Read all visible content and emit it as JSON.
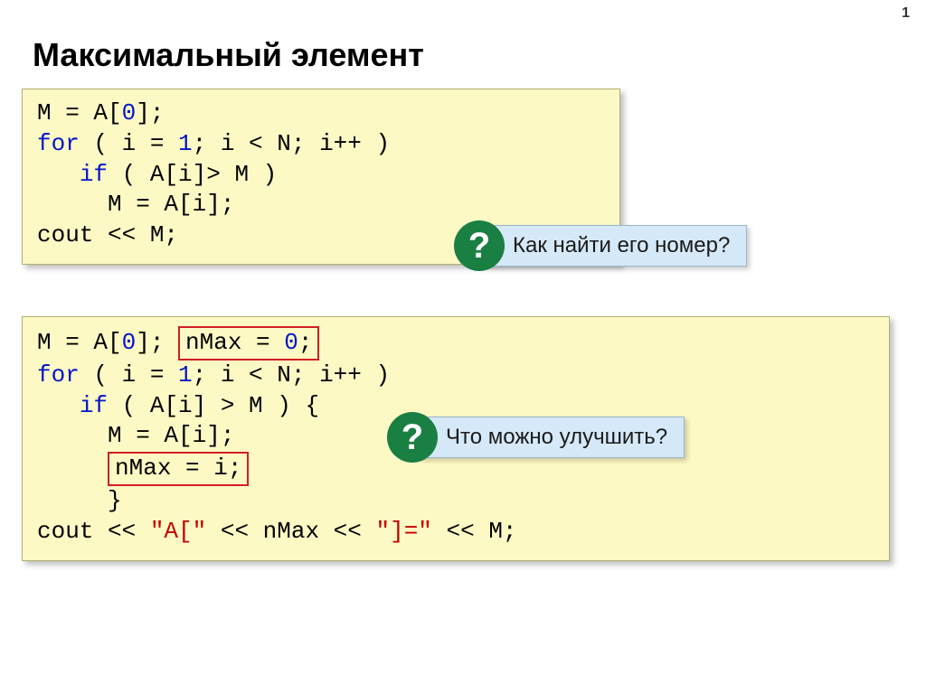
{
  "page_number": "1",
  "title": "Максимальный элемент",
  "code1": {
    "line1_a": "M = A[",
    "line1_zero": "0",
    "line1_b": "];",
    "line2_for": "for",
    "line2_a": " ( i = ",
    "line2_one": "1",
    "line2_b": "; i < N; i++ )",
    "line3_if": "if",
    "line3_body": " ( A[i]> M )",
    "line4": "     M = A[i];",
    "line5": "cout << M;"
  },
  "question1": {
    "mark": "?",
    "text": "Как найти его номер?"
  },
  "code2": {
    "line1_a": "M = A[",
    "line1_zero": "0",
    "line1_b": "]; ",
    "line1_nmax_a": "nMax = ",
    "line1_nmax_zero": "0",
    "line1_nmax_b": ";",
    "line2_for": "for",
    "line2_a": " ( i = ",
    "line2_one": "1",
    "line2_b": "; i < N; i++ )",
    "line3_if": "if",
    "line3_body": " ( A[i] > M ) {",
    "line4": "     M = A[i];",
    "line5_pad": "     ",
    "line5_box": "nMax = i;",
    "line6": "     }",
    "line7_a": "cout << ",
    "line7_s1": "\"A[\"",
    "line7_b": " << nMax << ",
    "line7_s2": "\"]=\"",
    "line7_c": " << M;"
  },
  "question2": {
    "mark": "?",
    "text": "Что можно улучшить?"
  }
}
